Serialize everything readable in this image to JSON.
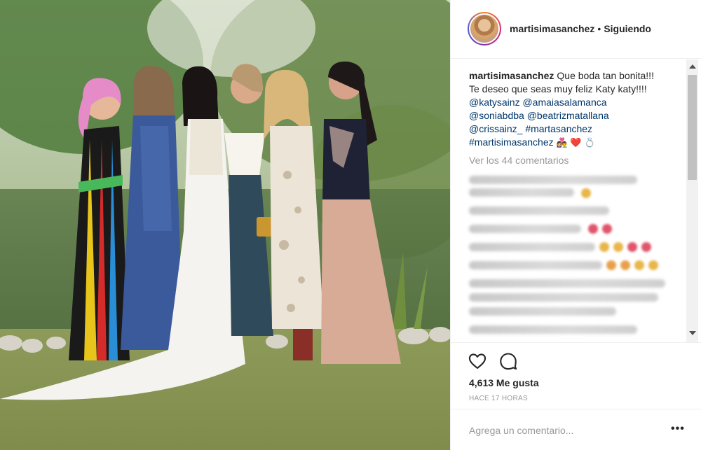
{
  "post": {
    "photo_alt": "",
    "username": "martisimasanchez",
    "separator": "•",
    "follow_status": "Siguiendo"
  },
  "caption": {
    "username": "martisimasanchez",
    "text_1": "Que boda tan bonita!!!",
    "text_2": "Te deseo que seas muy feliz Katy katy!!!!",
    "mentions": [
      "@katysainz",
      "@amaiasalamanca",
      "@soniabdba",
      "@beatrizmatallana",
      "@crissainz_"
    ],
    "hashtags": [
      "#martasanchez",
      "#martisimasanchez"
    ],
    "emojis": "👩‍❤️‍👨 ❤️ 💍"
  },
  "comments": {
    "view_all": "Ver los 44 comentarios"
  },
  "actions": {
    "like_icon": "heart-outline-icon",
    "comment_icon": "comment-bubble-icon",
    "likes": "4,613 Me gusta",
    "time": "HACE 17 HORAS"
  },
  "add_comment": {
    "placeholder": "Agrega un comentario...",
    "more": "•••"
  },
  "colors": {
    "link": "#003569",
    "muted": "#999999",
    "text": "#262626",
    "border": "#efefef"
  }
}
